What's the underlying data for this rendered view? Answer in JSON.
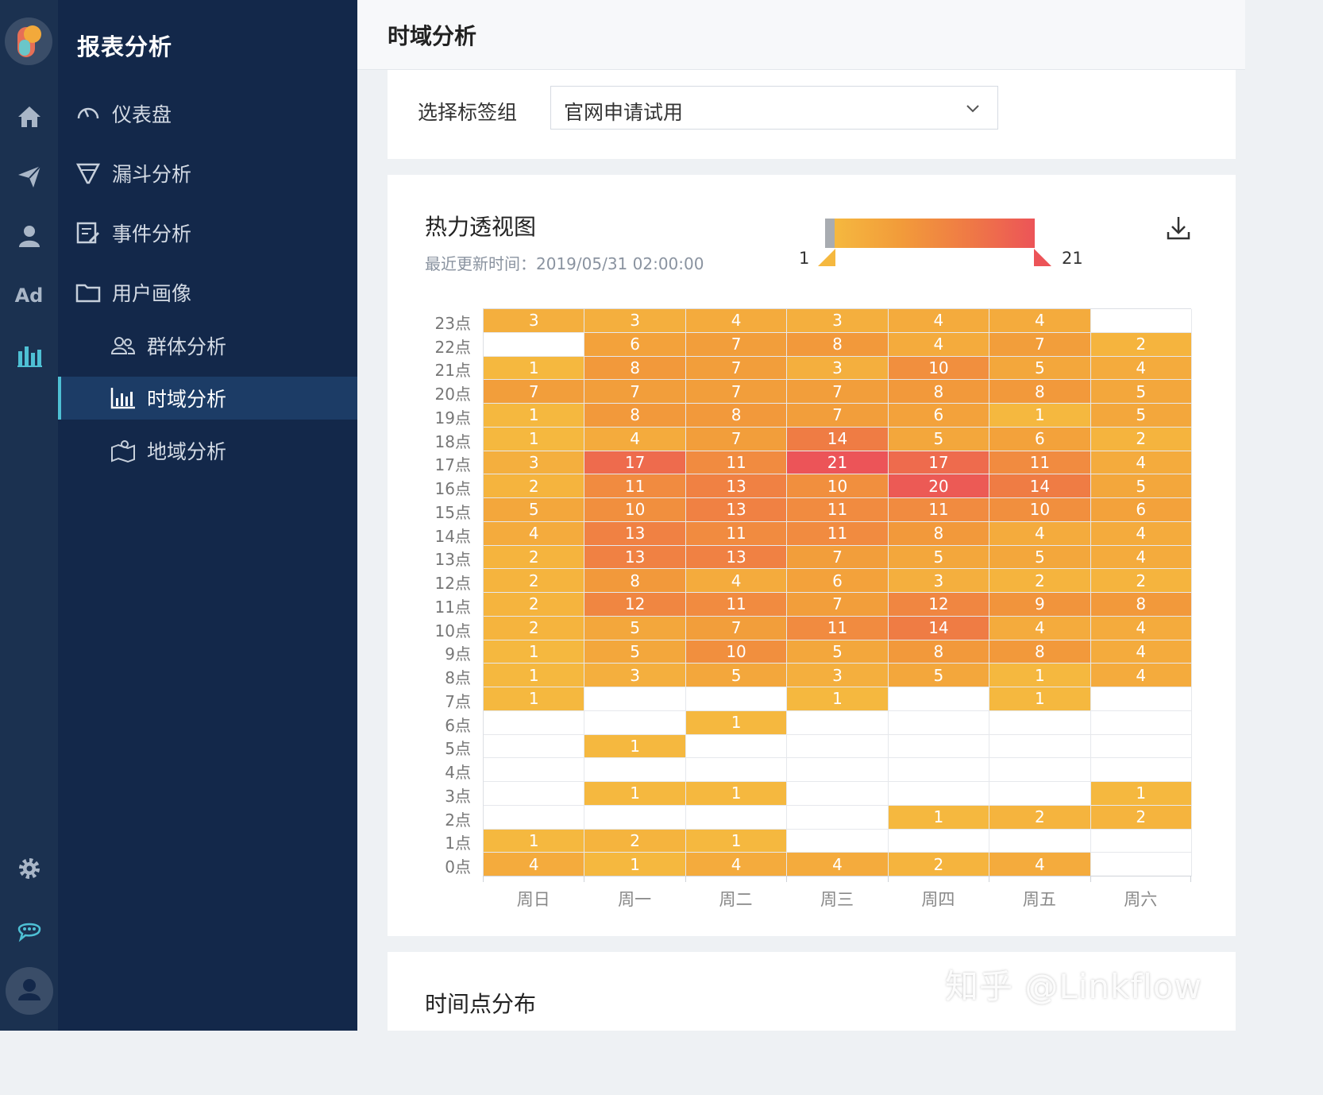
{
  "app": {
    "title": "报表分析"
  },
  "rail": {
    "icons": [
      "home-icon",
      "send-icon",
      "user-icon",
      "ad-icon",
      "bar-chart-icon",
      "settings-icon",
      "chat-icon",
      "profile-icon"
    ],
    "ad_text": "Ad",
    "accent": "#4ec0d4"
  },
  "nav": {
    "items": [
      {
        "label": "仪表盘",
        "icon": "gauge-icon"
      },
      {
        "label": "漏斗分析",
        "icon": "funnel-icon"
      },
      {
        "label": "事件分析",
        "icon": "event-icon"
      },
      {
        "label": "用户画像",
        "icon": "folder-icon"
      },
      {
        "label": "群体分析",
        "icon": "group-icon"
      },
      {
        "label": "时域分析",
        "icon": "bar-chart-icon",
        "active": true
      },
      {
        "label": "地域分析",
        "icon": "map-icon"
      }
    ]
  },
  "header": {
    "title": "时域分析"
  },
  "filter": {
    "label": "选择标签组",
    "selected": "官网申请试用"
  },
  "heatmap": {
    "title": "热力透视图",
    "updated_label": "最近更新时间：",
    "updated_value": "2019/05/31 02:00:00",
    "legend_min": "1",
    "legend_max": "21"
  },
  "chart_data": {
    "type": "heatmap",
    "title": "热力透视图",
    "x": [
      "周日",
      "周一",
      "周二",
      "周三",
      "周四",
      "周五",
      "周六"
    ],
    "y": [
      "23点",
      "22点",
      "21点",
      "20点",
      "19点",
      "18点",
      "17点",
      "16点",
      "15点",
      "14点",
      "13点",
      "12点",
      "11点",
      "10点",
      "9点",
      "8点",
      "7点",
      "6点",
      "5点",
      "4点",
      "3点",
      "2点",
      "1点",
      "0点"
    ],
    "values": [
      [
        3,
        3,
        4,
        3,
        4,
        4,
        null
      ],
      [
        null,
        6,
        7,
        8,
        4,
        7,
        2
      ],
      [
        1,
        8,
        7,
        3,
        10,
        5,
        4
      ],
      [
        7,
        7,
        7,
        7,
        8,
        8,
        5
      ],
      [
        1,
        8,
        8,
        7,
        6,
        1,
        5
      ],
      [
        1,
        4,
        7,
        14,
        5,
        6,
        2
      ],
      [
        3,
        17,
        11,
        21,
        17,
        11,
        4
      ],
      [
        2,
        11,
        13,
        10,
        20,
        14,
        5
      ],
      [
        5,
        10,
        13,
        11,
        11,
        10,
        6
      ],
      [
        4,
        13,
        11,
        11,
        8,
        4,
        4
      ],
      [
        2,
        13,
        13,
        7,
        5,
        5,
        4
      ],
      [
        2,
        8,
        4,
        6,
        3,
        2,
        2
      ],
      [
        2,
        12,
        11,
        7,
        12,
        9,
        8
      ],
      [
        2,
        5,
        7,
        11,
        14,
        4,
        4
      ],
      [
        1,
        5,
        10,
        5,
        8,
        8,
        4
      ],
      [
        1,
        3,
        5,
        3,
        5,
        1,
        4
      ],
      [
        1,
        null,
        null,
        1,
        null,
        1,
        null
      ],
      [
        null,
        null,
        1,
        null,
        null,
        null,
        null
      ],
      [
        null,
        1,
        null,
        null,
        null,
        null,
        null
      ],
      [
        null,
        null,
        null,
        null,
        null,
        null,
        null
      ],
      [
        null,
        1,
        1,
        null,
        null,
        null,
        1
      ],
      [
        null,
        null,
        null,
        null,
        1,
        2,
        2
      ],
      [
        1,
        2,
        1,
        null,
        null,
        null,
        null
      ],
      [
        4,
        1,
        4,
        4,
        2,
        4,
        null
      ]
    ],
    "min": 1,
    "max": 21,
    "colors": [
      "#f5b83f",
      "#f29b3a",
      "#ef7a45",
      "#ec5458"
    ]
  },
  "distribution": {
    "title": "时间点分布"
  },
  "watermark": "知乎 @Linkflow"
}
